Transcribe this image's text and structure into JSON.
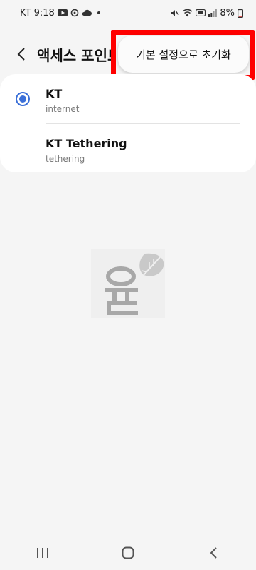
{
  "status_bar": {
    "time": "KT 9:18",
    "battery_percent": "8%",
    "left_icons": [
      "youtube-icon",
      "sync-icon",
      "cloud-icon",
      "dot-icon"
    ],
    "right_icons": [
      "mute-icon",
      "wifi-icon",
      "hd-icon",
      "signal-icon"
    ]
  },
  "header": {
    "title": "액세스 포인트",
    "back_icon": "chevron-left-icon"
  },
  "menu": {
    "reset_label": "기본 설정으로 초기화",
    "highlight_color": "#ff0000"
  },
  "apn_list": [
    {
      "name": "KT",
      "type": "internet",
      "selected": true
    },
    {
      "name": "KT Tethering",
      "type": "tethering",
      "selected": false
    }
  ],
  "accent_color": "#3a6fd8",
  "navigation": {
    "recents_icon": "recents-icon",
    "home_icon": "home-icon",
    "back_icon": "back-icon"
  }
}
